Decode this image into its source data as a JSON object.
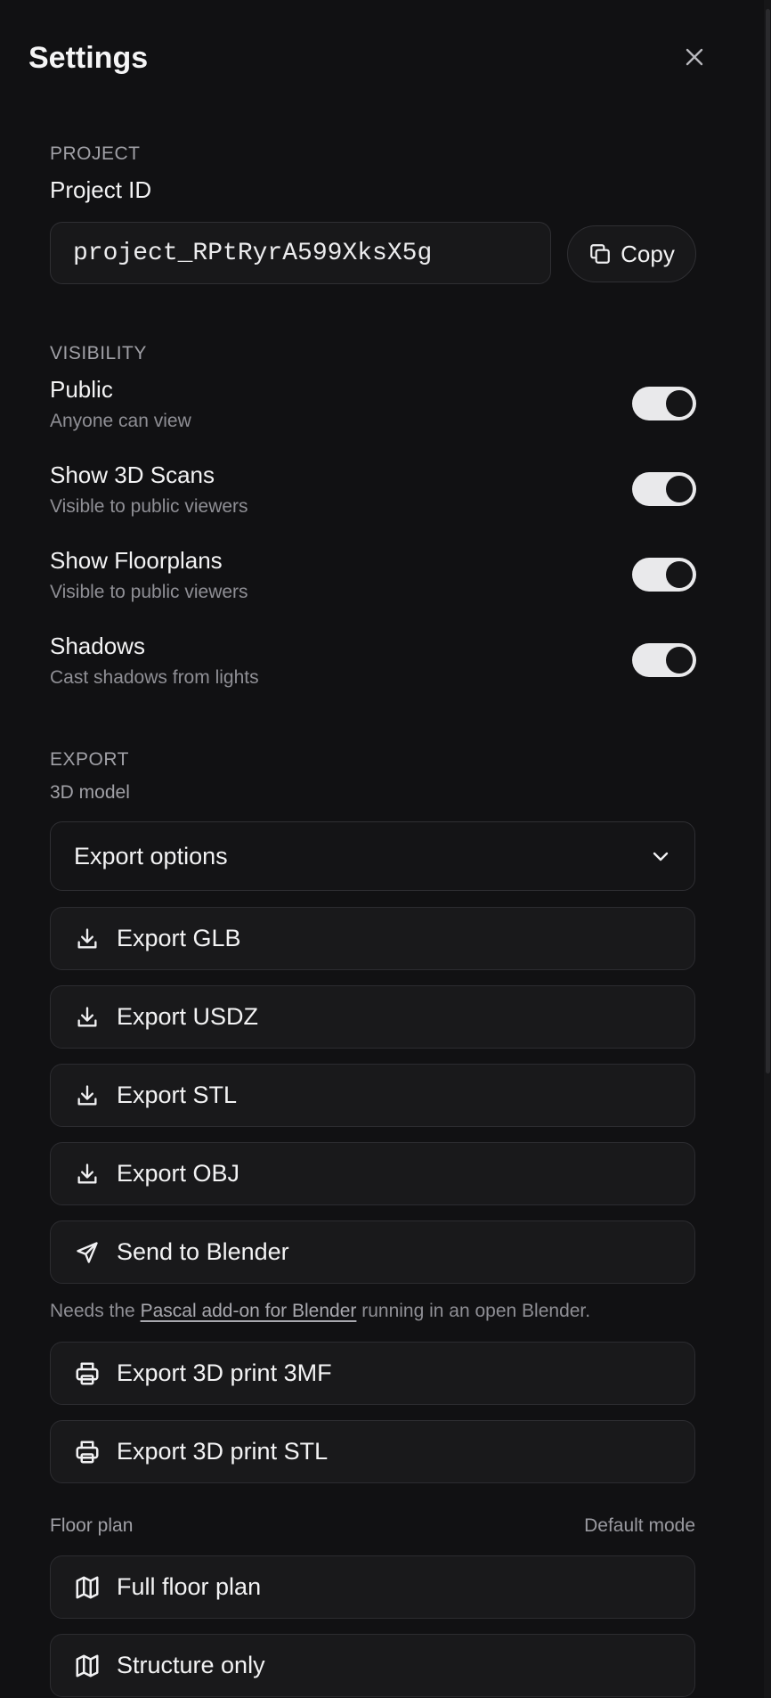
{
  "header": {
    "title": "Settings"
  },
  "project": {
    "section_label": "PROJECT",
    "field_label": "Project ID",
    "project_id": "project_RPtRyrA599XksX5g",
    "copy_label": "Copy"
  },
  "visibility": {
    "section_label": "VISIBILITY",
    "items": [
      {
        "title": "Public",
        "subtitle": "Anyone can view",
        "enabled": true
      },
      {
        "title": "Show 3D Scans",
        "subtitle": "Visible to public viewers",
        "enabled": true
      },
      {
        "title": "Show Floorplans",
        "subtitle": "Visible to public viewers",
        "enabled": true
      },
      {
        "title": "Shadows",
        "subtitle": "Cast shadows from lights",
        "enabled": true
      }
    ]
  },
  "export": {
    "section_label": "EXPORT",
    "subsection_label": "3D model",
    "options_select": "Export options",
    "buttons": [
      {
        "label": "Export GLB",
        "icon": "download-icon"
      },
      {
        "label": "Export USDZ",
        "icon": "download-icon"
      },
      {
        "label": "Export STL",
        "icon": "download-icon"
      },
      {
        "label": "Export OBJ",
        "icon": "download-icon"
      },
      {
        "label": "Send to Blender",
        "icon": "send-icon"
      }
    ],
    "blender_note": {
      "prefix": "Needs the",
      "link": "Pascal add-on for Blender",
      "suffix": "running in an open Blender."
    },
    "print_buttons": [
      {
        "label": "Export 3D print 3MF",
        "icon": "printer-icon"
      },
      {
        "label": "Export 3D print STL",
        "icon": "printer-icon"
      }
    ]
  },
  "floor_plan": {
    "label": "Floor plan",
    "mode_label": "Default mode",
    "buttons": [
      {
        "label": "Full floor plan",
        "icon": "map-icon"
      },
      {
        "label": "Structure only",
        "icon": "map-icon"
      }
    ]
  }
}
